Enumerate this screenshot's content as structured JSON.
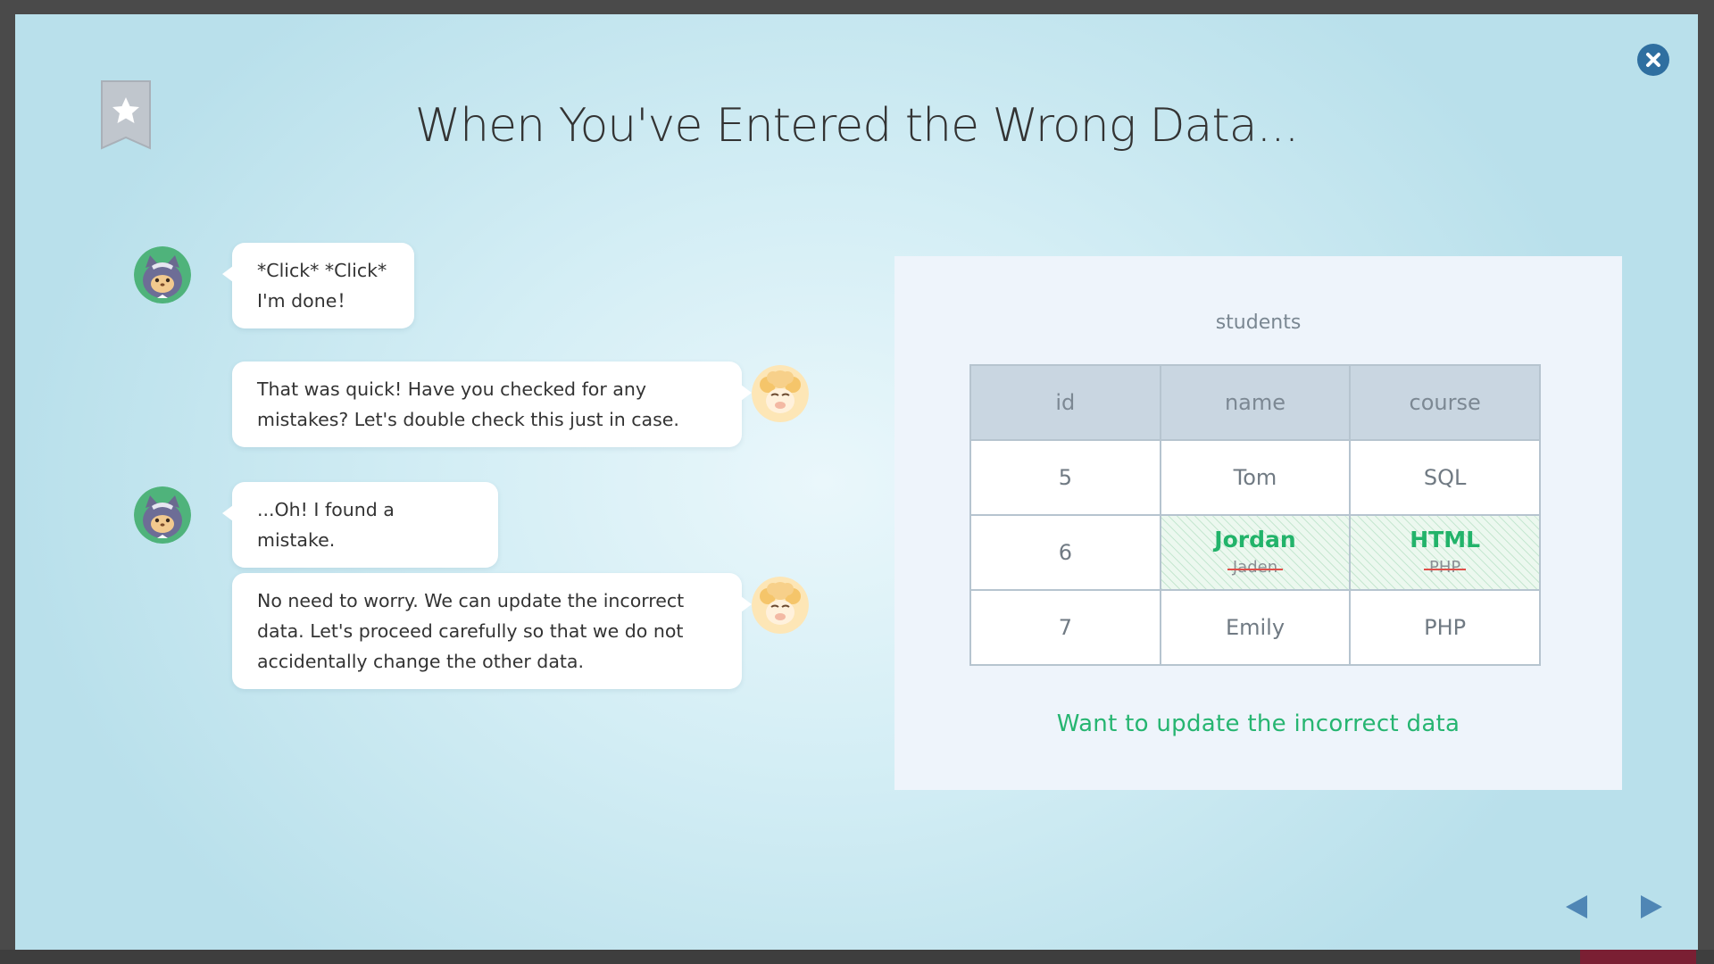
{
  "title": "When You've Entered the Wrong Data...",
  "icons": {
    "close": "close-icon",
    "bookmark": "bookmark-star-icon",
    "prev": "triangle-left-icon",
    "next": "triangle-right-icon"
  },
  "colors": {
    "accent_green": "#26b571",
    "close_blue": "#2f6fa0",
    "strike_red": "#e0504a"
  },
  "conversation": [
    {
      "speaker": "cat",
      "side": "left",
      "lines": [
        "*Click* *Click*",
        "I'm done！"
      ]
    },
    {
      "speaker": "sheep",
      "side": "right",
      "lines": [
        "That was quick! Have you checked for any",
        "mistakes? Let's double check this just in case."
      ]
    },
    {
      "speaker": "cat",
      "side": "left",
      "lines": [
        "...Oh! I found a mistake."
      ]
    },
    {
      "speaker": "sheep",
      "side": "right",
      "lines": [
        "No need to worry. We can update the incorrect",
        "data. Let's proceed carefully so that we do not",
        "accidentally change the other data."
      ]
    }
  ],
  "table": {
    "caption": "students",
    "headers": [
      "id",
      "name",
      "course"
    ],
    "rows": [
      {
        "id": "5",
        "name": "Tom",
        "course": "SQL"
      },
      {
        "id": "6",
        "name_new": "Jordan",
        "name_old": "Jaden",
        "course_new": "HTML",
        "course_old": "PHP"
      },
      {
        "id": "7",
        "name": "Emily",
        "course": "PHP"
      }
    ]
  },
  "panel_note": "Want to update the incorrect data"
}
